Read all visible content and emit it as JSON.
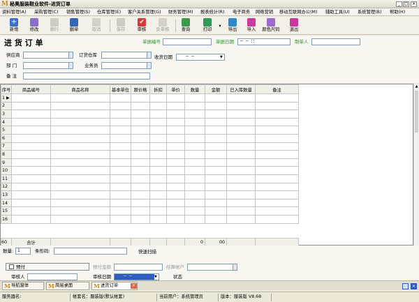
{
  "window": {
    "title": "秘奥服装鞋业软件-进货订单"
  },
  "menu": [
    "资料管理(A)",
    "采购管理(C)",
    "销售管理(S)",
    "仓库管理(E)",
    "客户关系管理(G)",
    "财务管理(M)",
    "报表统计(R)",
    "电子商务",
    "网络营销",
    "移动互联网办公(M)",
    "辅助工具(U)",
    "系统管理(B)",
    "帮助(H)"
  ],
  "toolbar": {
    "new": "新增",
    "edit": "修改",
    "del_row": "删行",
    "del_doc": "删单",
    "cancel": "取消",
    "save": "保存",
    "audit": "审核",
    "unaudit": "反审核",
    "query": "查询",
    "print": "打印",
    "export": "导出",
    "import": "导入",
    "color_size": "颜色尺码",
    "exit": "退出"
  },
  "form": {
    "heading": "进 货 订 单",
    "doc_no_label": "单据编号",
    "doc_date_label": "单据日期",
    "doc_date_value": "－ －   ：：",
    "maker_label": "制单人",
    "supplier_label": "供应商",
    "warehouse_label": "订货仓库",
    "receive_date_label": "收货日期",
    "receive_date_value": "－ －",
    "dept_label": "部 门",
    "salesman_label": "业务员",
    "remark_label": "备 注"
  },
  "grid": {
    "columns": [
      "序号",
      "商品编号",
      "商品名称",
      "基本单位",
      "原价格",
      "折扣",
      "单价",
      "数量",
      "金额",
      "已入库数量",
      "备注"
    ],
    "rows": [
      "1",
      "2",
      "3",
      "4",
      "5",
      "6",
      "7",
      "8",
      "9",
      "10",
      "11",
      "12",
      "13",
      "14",
      "15",
      "16"
    ],
    "total_row": {
      "index": "60",
      "label": "合计",
      "qty": "0",
      "amount": "00"
    }
  },
  "bottom": {
    "qty_label": "数量:",
    "qty_value": "1",
    "barcode_label": "条形码:",
    "quick_scan": "快速扫描",
    "prepay_label": "预付",
    "prepay_amount_label": "预付金额",
    "settle_account_label": "结算帐户",
    "auditor_label": "审核人",
    "audit_date_label": "审核日期",
    "audit_date_value": "－ －",
    "status_label": "状态"
  },
  "tabs": [
    "导航窗体",
    "简易桌面",
    "进货订单"
  ],
  "status": {
    "server": "服务器名:",
    "account": "帐套名：服装版(默认帐套)",
    "user": "当前用户：系统管理员",
    "version": "版本：服装版 V8.68"
  },
  "colors": {
    "accent_blue": "#2f5dbf",
    "label_green": "#2a9a2a",
    "logo": "#d08a10"
  }
}
